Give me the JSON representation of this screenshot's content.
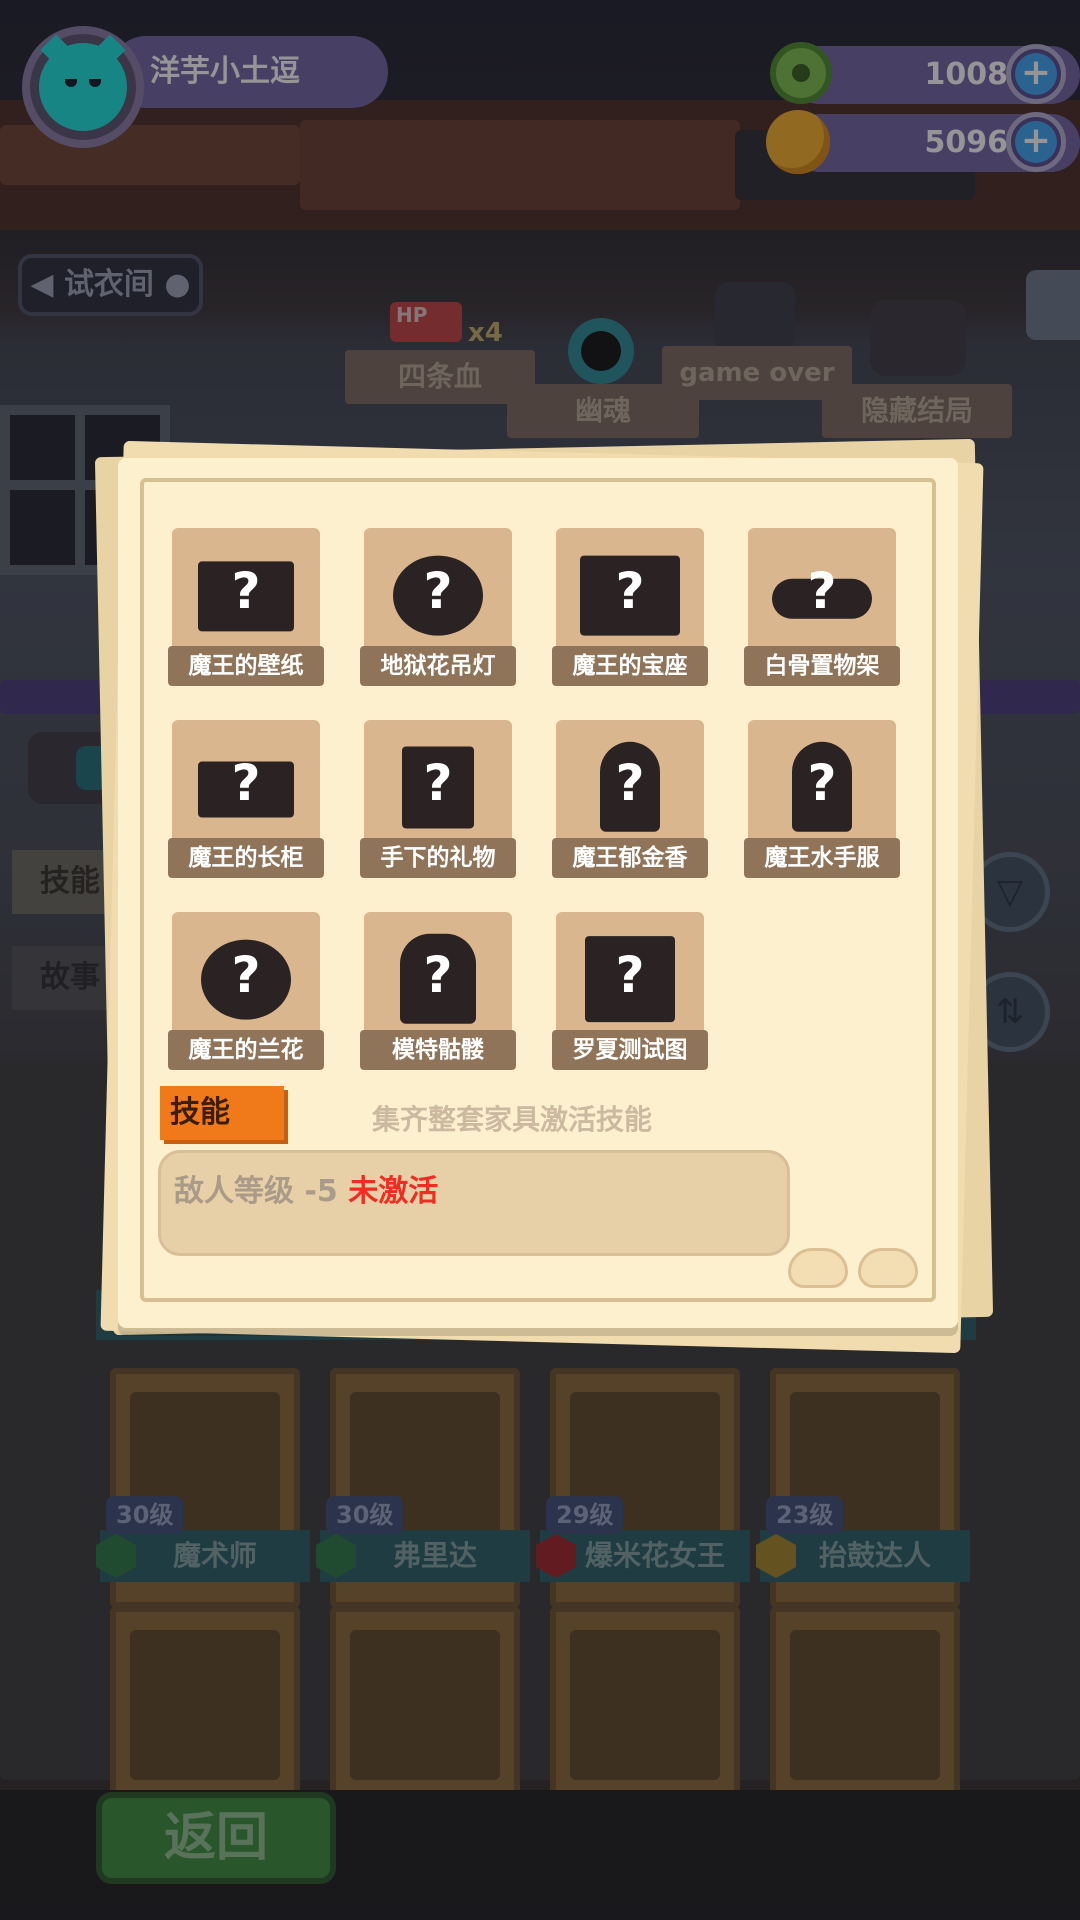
{
  "player": {
    "name": "洋芋小土逗"
  },
  "currencies": [
    {
      "icon": "green-donut-coin-icon",
      "value": "1008"
    },
    {
      "icon": "gold-planet-coin-icon",
      "value": "5096"
    }
  ],
  "fitting_room_label": "试衣间",
  "header_plaques": {
    "hp_badge": "HP",
    "hp_count": "x4",
    "four_hp": "四条血",
    "ghost": "幽魂",
    "game_over": "game over",
    "hidden_ending": "隐藏结局"
  },
  "side_tabs": {
    "skill": "技能",
    "story": "故事"
  },
  "furniture_set": {
    "items": [
      {
        "label": "魔王的壁纸",
        "mark": "?"
      },
      {
        "label": "地狱花吊灯",
        "mark": "?"
      },
      {
        "label": "魔王的宝座",
        "mark": "?"
      },
      {
        "label": "白骨置物架",
        "mark": "?"
      },
      {
        "label": "魔王的长柜",
        "mark": "?"
      },
      {
        "label": "手下的礼物",
        "mark": "?"
      },
      {
        "label": "魔王郁金香",
        "mark": "?"
      },
      {
        "label": "魔王水手服",
        "mark": "?"
      },
      {
        "label": "魔王的兰花",
        "mark": "?"
      },
      {
        "label": "模特骷髅",
        "mark": "?"
      },
      {
        "label": "罗夏测试图",
        "mark": "?"
      }
    ],
    "skill_tag": "技能",
    "skill_hint": "集齐整套家具激活技能",
    "skill_effect": "敌人等级 -5",
    "skill_status": "未激活"
  },
  "characters": [
    {
      "level": "30级",
      "name": "魔术师"
    },
    {
      "level": "30级",
      "name": "弗里达"
    },
    {
      "level": "29级",
      "name": "爆米花女王"
    },
    {
      "level": "23级",
      "name": "抬鼓达人"
    }
  ],
  "back_button": "返回",
  "colors": {
    "paper": "#fdf0cf",
    "slot": "#d9b68e",
    "label_bg": "#8f7459",
    "skill_orange": "#f07a1a",
    "inactive_red": "#f02d22",
    "name_pill": "#7467a5",
    "avatar_cyan": "#1de3e0"
  }
}
